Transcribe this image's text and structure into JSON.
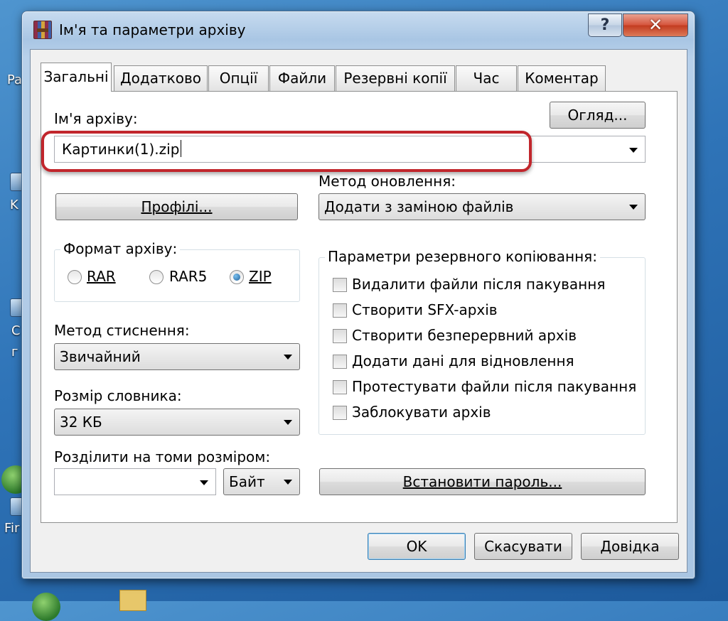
{
  "desktop": {
    "fragments": [
      "Pa",
      "K",
      "C",
      "г",
      "Fir"
    ]
  },
  "window": {
    "title": "Ім'я та параметри архіву",
    "help_glyph": "?",
    "close_glyph": "✕"
  },
  "tabs": [
    {
      "label": "Загальні",
      "active": true
    },
    {
      "label": "Додатково"
    },
    {
      "label": "Опції"
    },
    {
      "label": "Файли"
    },
    {
      "label": "Резервні копії"
    },
    {
      "label": "Час"
    },
    {
      "label": "Коментар"
    }
  ],
  "general": {
    "archive_name_label": "Ім'я архіву:",
    "archive_name_value": "Картинки(1).zip",
    "browse_button": "Огляд...",
    "update_method_label": "Метод оновлення:",
    "update_method_value": "Додати з заміною файлів",
    "profiles_button": "Профілі...",
    "format_group_title": "Формат архіву:",
    "formats": [
      {
        "label": "RAR",
        "selected": false
      },
      {
        "label": "RAR5",
        "selected": false
      },
      {
        "label": "ZIP",
        "selected": true
      }
    ],
    "compression_label": "Метод стиснення:",
    "compression_value": "Звичайний",
    "dictionary_label": "Розмір словника:",
    "dictionary_value": "32 КБ",
    "split_label": "Розділити на томи розміром:",
    "split_value": "",
    "split_unit": "Байт",
    "backup_group_title": "Параметри резервного копіювання:",
    "backup_options": [
      {
        "label": "Видалити файли після пакування",
        "checked": false
      },
      {
        "label": "Створити SFX-архів",
        "checked": false
      },
      {
        "label": "Створити безперервний архів",
        "checked": false
      },
      {
        "label": "Додати дані для відновлення",
        "checked": false
      },
      {
        "label": "Протестувати файли після пакування",
        "checked": false
      },
      {
        "label": "Заблокувати архів",
        "checked": false
      }
    ],
    "password_button": "Встановити пароль..."
  },
  "footer": {
    "ok": "OK",
    "cancel": "Скасувати",
    "help": "Довідка"
  },
  "colors": {
    "highlight": "#c1262c",
    "desktop": "#2f74b8"
  }
}
